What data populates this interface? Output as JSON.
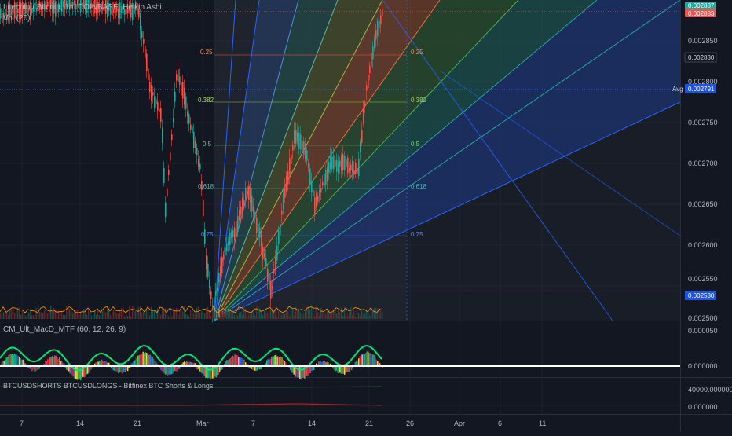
{
  "header": {
    "symbol_line": "Litecoin / Bitcoin, 1h, COINBASE, Heikin Ashi",
    "vol_label": "Vol (20)"
  },
  "price_axis": {
    "ticks": [
      "0.002850",
      "0.002800",
      "0.002750",
      "0.002700",
      "0.002650",
      "0.002600",
      "0.002550",
      "0.002500"
    ],
    "tag_high": "0.002887",
    "tag_current": "0.002883",
    "tag_830": "0.002830",
    "avg_label": "Avg",
    "tag_avg": "0.002791",
    "tag_low": "0.002530"
  },
  "fib_levels": {
    "left": [
      "0.25",
      "0.382",
      "0.5",
      "0.618",
      "0.75"
    ],
    "right": [
      "0.25",
      "0.382",
      "0.5",
      "0.618",
      "0.75"
    ]
  },
  "macd_panel": {
    "title": "CM_Ult_MacD_MTF (60, 12, 26, 9)",
    "ticks": [
      "0.000050",
      "0.000000"
    ]
  },
  "shorts_panel": {
    "title": "BTCUSDSHORTS BTCUSDLONGS - Bitfinex BTC Shorts & Longs",
    "ticks": [
      "40000.000000",
      "0.000000"
    ]
  },
  "time_axis": {
    "labels": [
      "7",
      "14",
      "21",
      "Mar",
      "7",
      "14",
      "21",
      "26",
      "Apr",
      "6",
      "11"
    ]
  },
  "colors": {
    "background": "#131722",
    "up": "#26a69a",
    "down": "#ef5350",
    "level_line": "#2962ff",
    "avg_tag": "#1e53e5",
    "current_tag": "#ef5350"
  }
}
